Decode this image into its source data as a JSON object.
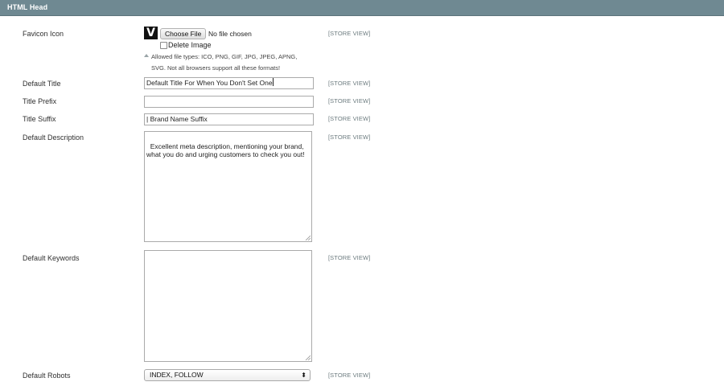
{
  "section": {
    "title": "HTML Head"
  },
  "favicon": {
    "label": "Favicon Icon",
    "logo_letter": "V",
    "choose_file_label": "Choose File",
    "no_file_text": "No file chosen",
    "delete_label": "Delete Image",
    "delete_checked": false,
    "note_line1": "Allowed file types: ICO, PNG, GIF, JPG, JPEG, APNG,",
    "note_line2": "SVG. Not all browsers support all these formats!",
    "scope": "[STORE VIEW]"
  },
  "default_title": {
    "label": "Default Title",
    "value": "Default Title For When You Don't Set One",
    "scope": "[STORE VIEW]"
  },
  "title_prefix": {
    "label": "Title Prefix",
    "value": "",
    "scope": "[STORE VIEW]"
  },
  "title_suffix": {
    "label": "Title Suffix",
    "value": "| Brand Name Suffix",
    "scope": "[STORE VIEW]"
  },
  "default_description": {
    "label": "Default Description",
    "value": "Excellent meta description, mentioning your brand, what you do and urging customers to check you out!",
    "scope": "[STORE VIEW]"
  },
  "default_keywords": {
    "label": "Default Keywords",
    "value": "",
    "scope": "[STORE VIEW]"
  },
  "default_robots": {
    "label": "Default Robots",
    "selected": "INDEX, FOLLOW",
    "scope": "[STORE VIEW]"
  },
  "icons": {
    "select_arrows": "select-arrows-icon",
    "note_arrow": "note-arrow-icon",
    "resize_grip": "resize-grip-icon"
  },
  "colors": {
    "header_bg": "#6f8992",
    "scope_text": "#6c7b7f"
  }
}
